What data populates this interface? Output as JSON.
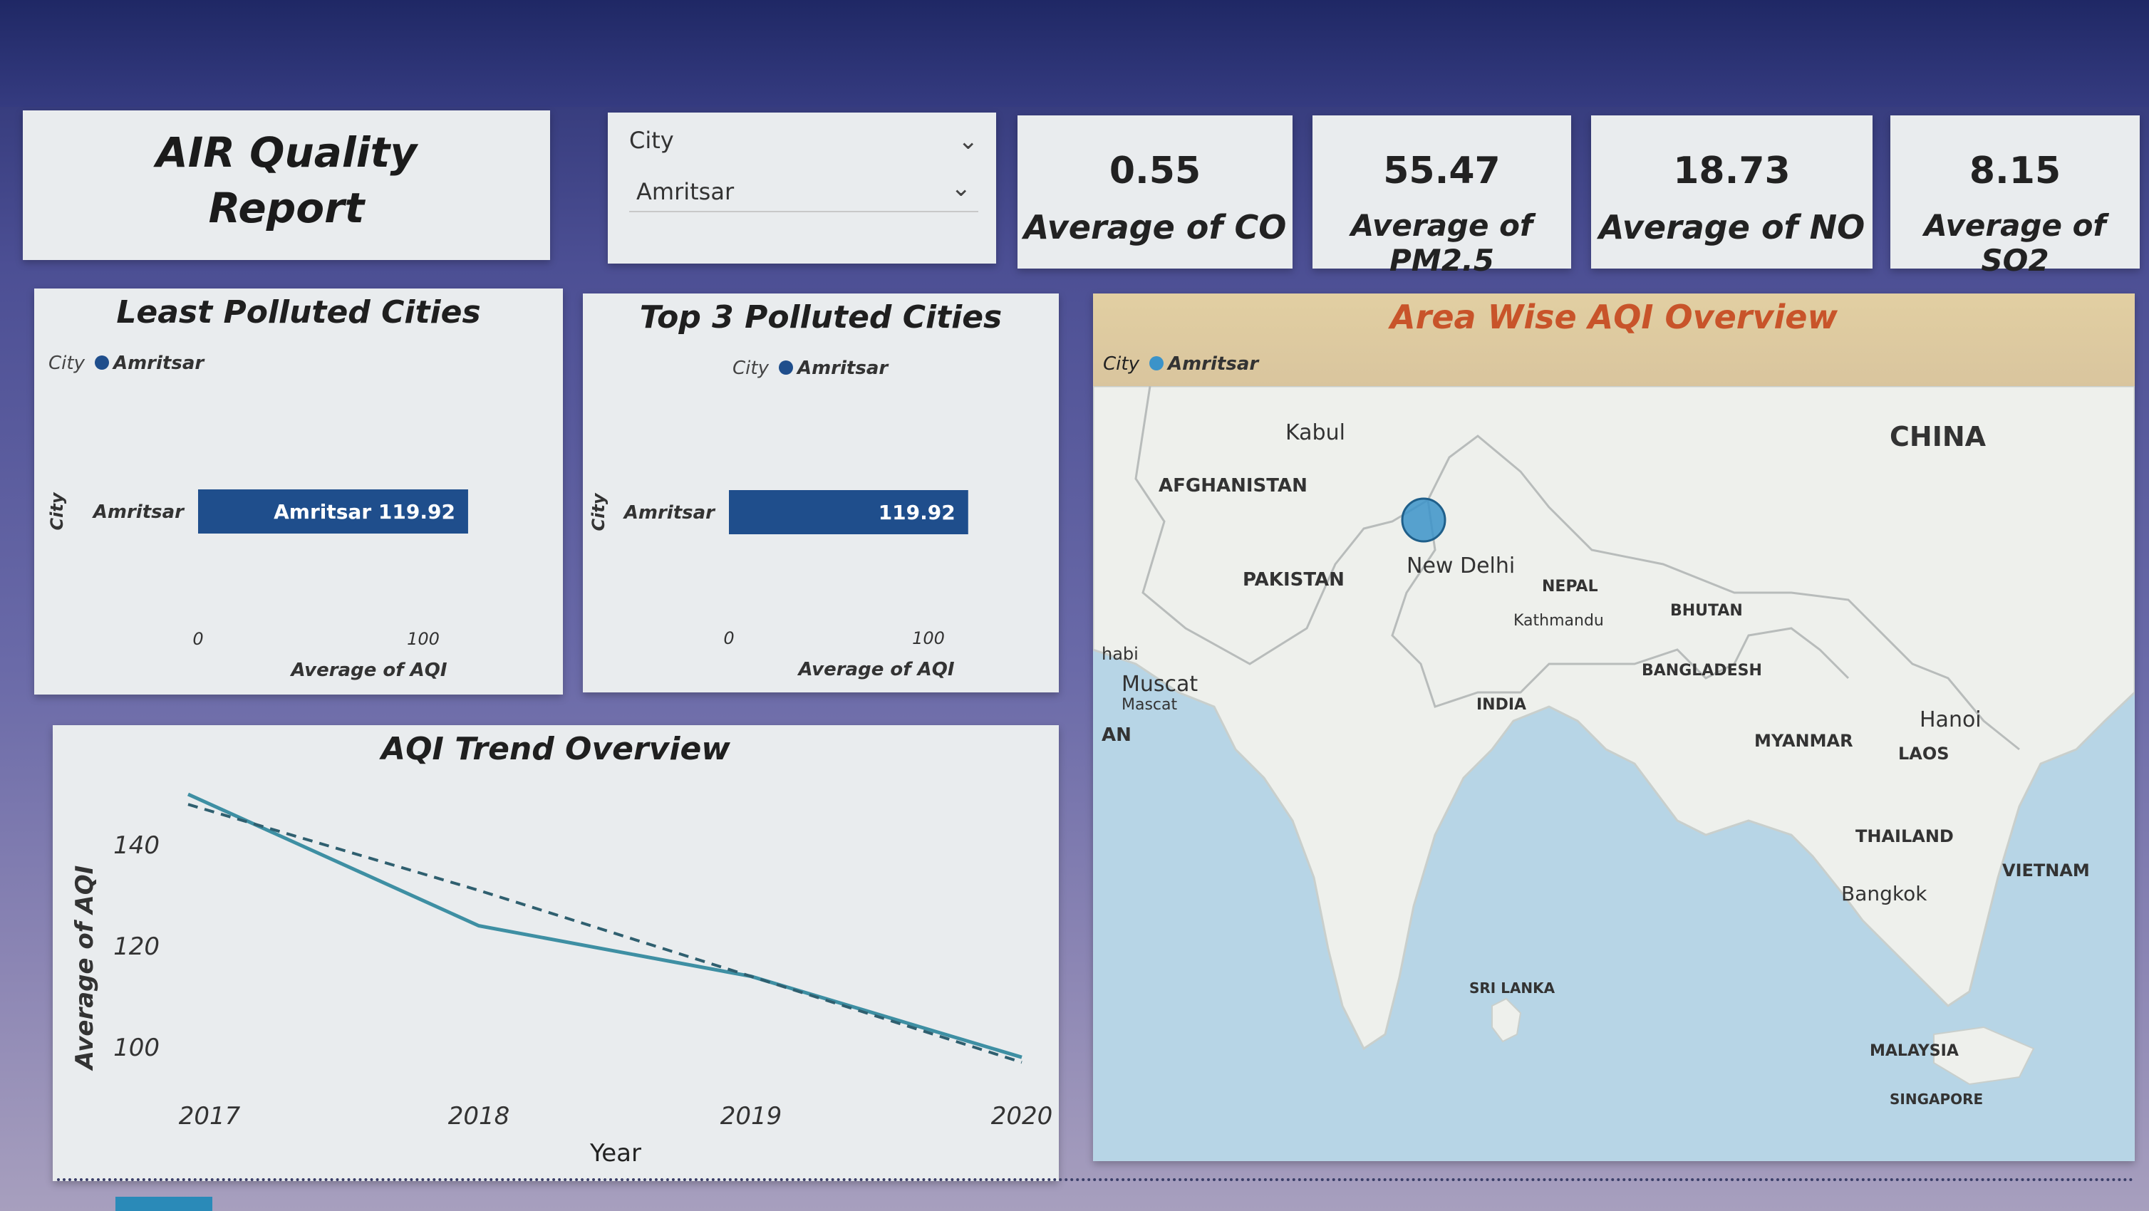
{
  "report": {
    "title_line1": "AIR Quality",
    "title_line2": "Report"
  },
  "slicer": {
    "header": "City",
    "selected": "Amritsar"
  },
  "kpis": [
    {
      "value": "0.55",
      "label": "Average of CO"
    },
    {
      "value": "55.47",
      "label": "Average of PM2.5"
    },
    {
      "value": "18.73",
      "label": "Average of NO"
    },
    {
      "value": "8.15",
      "label": "Average of SO2"
    }
  ],
  "least_polluted": {
    "title": "Least Polluted Cities",
    "legend_label": "City",
    "legend_item": "Amritsar",
    "bar_label": "Amritsar 119.92"
  },
  "top3_polluted": {
    "title": "Top 3 Polluted Cities",
    "legend_label": "City",
    "legend_item": "Amritsar",
    "bar_label": "119.92"
  },
  "trend": {
    "title": "AQI Trend Overview"
  },
  "map": {
    "title": "Area Wise AQI Overview",
    "legend_label": "City",
    "legend_item": "Amritsar",
    "labels": [
      "Kabul",
      "AFGHANISTAN",
      "PAKISTAN",
      "New Delhi",
      "NEPAL",
      "Kathmandu",
      "BHUTAN",
      "BANGLADESH",
      "INDIA",
      "CHINA",
      "MYANMAR",
      "LAOS",
      "Hanoi",
      "THAILAND",
      "VIETNAM",
      "Bangkok",
      "SRI LANKA",
      "MALAYSIA",
      "SINGAPORE",
      "Muscat",
      "Mascat",
      "AN",
      "habi"
    ]
  },
  "colors": {
    "bar": "#1f4e8c",
    "trend_line": "#3e8fa3",
    "map_water": "#b7d5e6",
    "map_land": "#eef0ec",
    "map_marker": "#3b93c9",
    "map_title": "#c8542a"
  },
  "chart_data": [
    {
      "type": "bar",
      "orientation": "horizontal",
      "title": "Least Polluted Cities",
      "xlabel": "Average of AQI",
      "ylabel": "City",
      "categories": [
        "Amritsar"
      ],
      "values": [
        119.92
      ],
      "xticks": [
        0,
        100
      ],
      "legend": {
        "title": "City",
        "items": [
          "Amritsar"
        ],
        "position": "top-left"
      }
    },
    {
      "type": "bar",
      "orientation": "horizontal",
      "title": "Top 3 Polluted Cities",
      "xlabel": "Average of AQI",
      "ylabel": "City",
      "categories": [
        "Amritsar"
      ],
      "values": [
        119.92
      ],
      "xticks": [
        0,
        100
      ],
      "legend": {
        "title": "City",
        "items": [
          "Amritsar"
        ],
        "position": "top"
      }
    },
    {
      "type": "line",
      "title": "AQI Trend Overview",
      "xlabel": "Year",
      "ylabel": "Average of AQI",
      "x": [
        "2017",
        "2018",
        "2019",
        "2020"
      ],
      "series": [
        {
          "values": [
            150,
            124,
            114,
            98
          ]
        }
      ],
      "trendline": [
        148,
        131,
        114,
        97
      ],
      "yticks": [
        100,
        120,
        140
      ],
      "ylim": [
        95,
        152
      ]
    }
  ]
}
